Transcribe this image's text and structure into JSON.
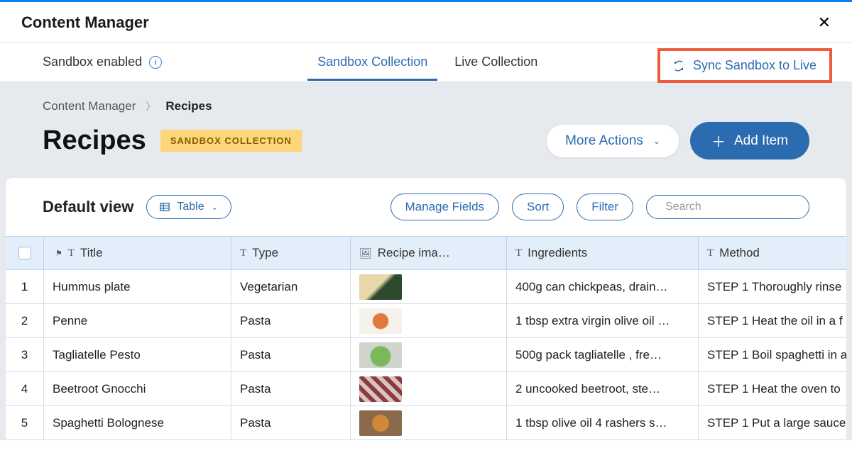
{
  "header": {
    "title": "Content Manager"
  },
  "tabs": {
    "sandbox_label": "Sandbox enabled",
    "tab1": "Sandbox Collection",
    "tab2": "Live Collection",
    "sync": "Sync Sandbox to Live"
  },
  "breadcrumb": {
    "root": "Content Manager",
    "current": "Recipes"
  },
  "page": {
    "title": "Recipes",
    "badge": "SANDBOX COLLECTION",
    "more": "More Actions",
    "add": "Add Item"
  },
  "view": {
    "title": "Default view",
    "selector": "Table",
    "manage": "Manage Fields",
    "sort": "Sort",
    "filter": "Filter",
    "search_placeholder": "Search"
  },
  "columns": {
    "title": "Title",
    "type": "Type",
    "image": "Recipe ima…",
    "ingredients": "Ingredients",
    "method": "Method"
  },
  "rows": [
    {
      "n": "1",
      "title": "Hummus plate",
      "type": "Vegetarian",
      "ingredients": "400g can chickpeas, drain…",
      "method": "STEP 1 Thoroughly rinse"
    },
    {
      "n": "2",
      "title": "Penne",
      "type": "Pasta",
      "ingredients": "1 tbsp extra virgin olive oil …",
      "method": "STEP 1 Heat the oil in a f"
    },
    {
      "n": "3",
      "title": "Tagliatelle Pesto",
      "type": "Pasta",
      "ingredients": "500g pack tagliatelle , fre…",
      "method": "STEP 1 Boil spaghetti in a"
    },
    {
      "n": "4",
      "title": "Beetroot Gnocchi",
      "type": "Pasta",
      "ingredients": "2 uncooked beetroot, ste…",
      "method": "STEP 1 Heat the oven to"
    },
    {
      "n": "5",
      "title": "Spaghetti Bolognese",
      "type": "Pasta",
      "ingredients": "1 tbsp olive oil 4 rashers s…",
      "method": "STEP 1 Put a large sauce"
    }
  ]
}
